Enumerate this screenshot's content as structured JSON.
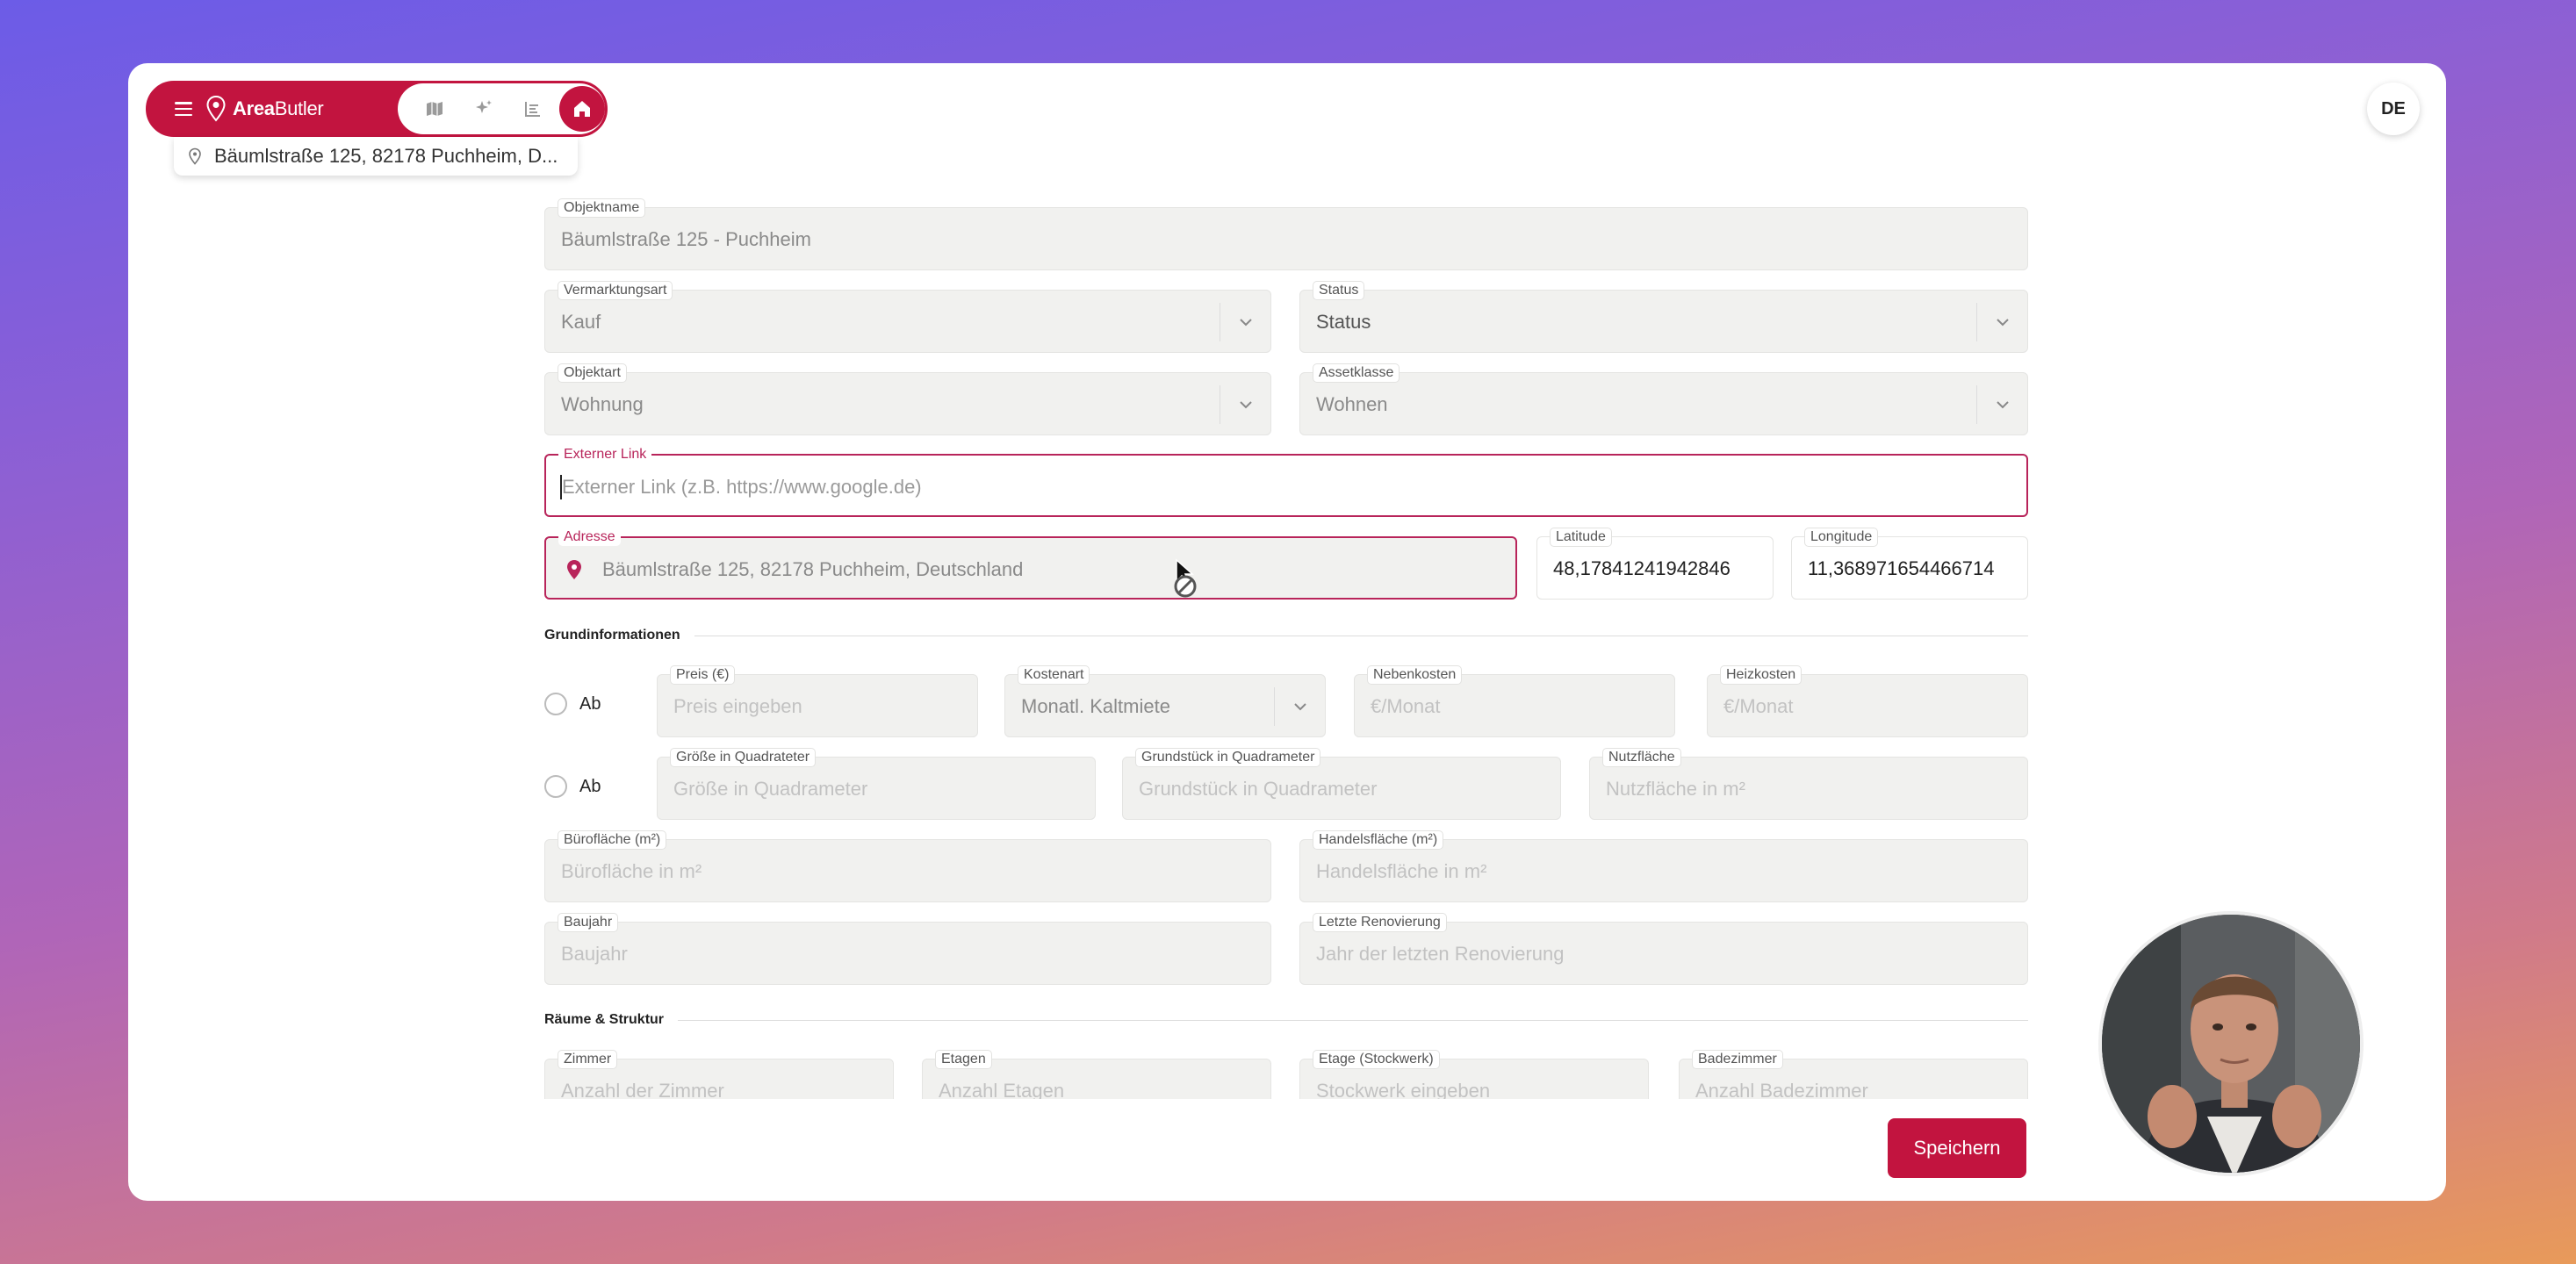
{
  "header": {
    "brand_bold": "Area",
    "brand_light": "Butler",
    "address_chip": "Bäumlstraße 125, 82178 Puchheim, D...",
    "language": "DE",
    "icons": [
      "hamburger-icon",
      "map-icon",
      "sparkle-icon",
      "list-icon",
      "home-icon"
    ]
  },
  "form": {
    "objektname": {
      "label": "Objektname",
      "value": "Bäumlstraße 125 - Puchheim"
    },
    "vermarktungsart": {
      "label": "Vermarktungsart",
      "value": "Kauf"
    },
    "status": {
      "label": "Status",
      "value": "Status"
    },
    "objektart": {
      "label": "Objektart",
      "value": "Wohnung"
    },
    "assetklasse": {
      "label": "Assetklasse",
      "value": "Wohnen"
    },
    "externer_link": {
      "label": "Externer Link",
      "placeholder": "Externer Link (z.B. https://www.google.de)"
    },
    "adresse": {
      "label": "Adresse",
      "value": "Bäumlstraße 125, 82178 Puchheim, Deutschland"
    },
    "latitude": {
      "label": "Latitude",
      "value": "48,17841241942846"
    },
    "longitude": {
      "label": "Longitude",
      "value": "11,368971654466714"
    },
    "grundinformationen": "Grundinformationen",
    "ab_label": "Ab",
    "preis": {
      "label": "Preis (€)",
      "placeholder": "Preis eingeben"
    },
    "kostenart": {
      "label": "Kostenart",
      "value": "Monatl. Kaltmiete"
    },
    "nebenkosten": {
      "label": "Nebenkosten",
      "placeholder": "€/Monat"
    },
    "heizkosten": {
      "label": "Heizkosten",
      "placeholder": "€/Monat"
    },
    "groesse": {
      "label": "Größe in Quadrateter",
      "placeholder": "Größe in Quadrameter"
    },
    "grundstueck": {
      "label": "Grundstück in Quadrameter",
      "placeholder": "Grundstück in Quadrameter"
    },
    "nutzflaeche": {
      "label": "Nutzfläche",
      "placeholder": "Nutzfläche in m²"
    },
    "bueroflaeche": {
      "label": "Bürofläche (m²)",
      "placeholder": "Bürofläche in m²"
    },
    "handelsflaeche": {
      "label": "Handelsfläche (m²)",
      "placeholder": "Handelsfläche in m²"
    },
    "baujahr": {
      "label": "Baujahr",
      "placeholder": "Baujahr"
    },
    "renovierung": {
      "label": "Letzte Renovierung",
      "placeholder": "Jahr der letzten Renovierung"
    },
    "raeume": "Räume & Struktur",
    "zimmer": {
      "label": "Zimmer",
      "placeholder": "Anzahl der Zimmer"
    },
    "etagen": {
      "label": "Etagen",
      "placeholder": "Anzahl Etagen"
    },
    "stockwerk": {
      "label": "Etage (Stockwerk)",
      "placeholder": "Stockwerk eingeben"
    },
    "badezimmer": {
      "label": "Badezimmer",
      "placeholder": "Anzahl Badezimmer"
    }
  },
  "actions": {
    "save": "Speichern"
  },
  "colors": {
    "accent": "#c2143f",
    "focus_border": "#b8245a"
  }
}
